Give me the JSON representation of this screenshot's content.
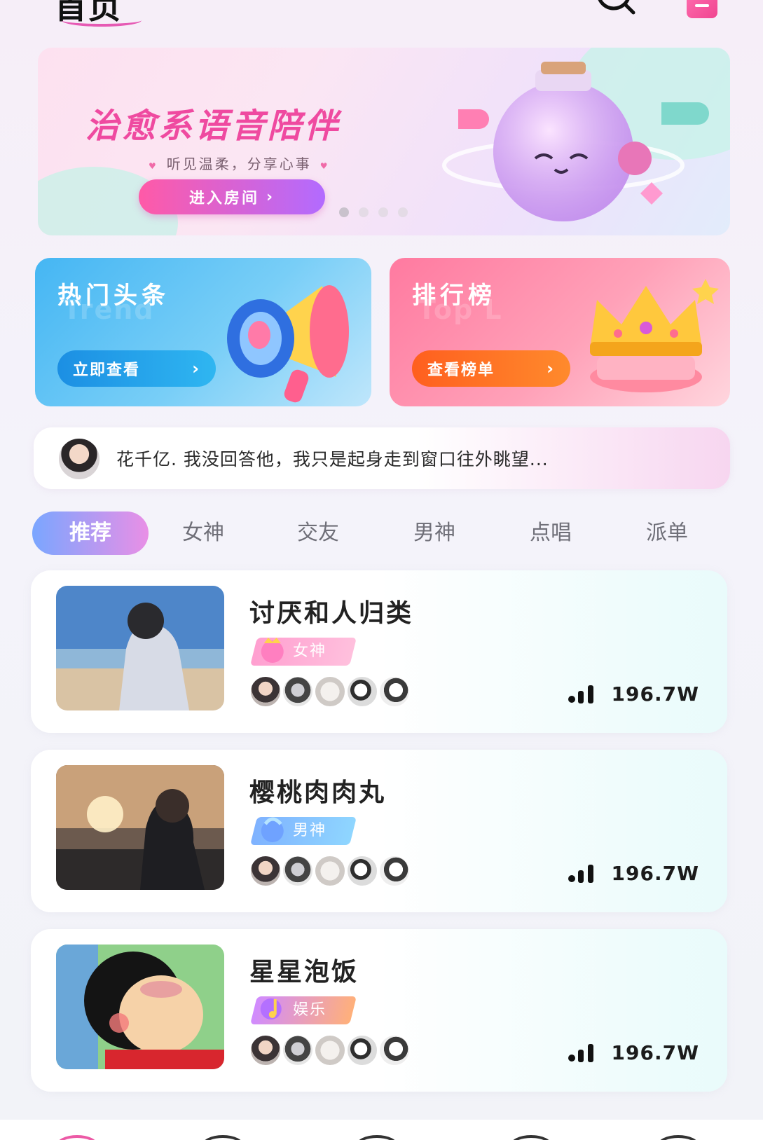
{
  "header": {
    "title": "首页",
    "search_icon": "search-icon",
    "menu_icon": "menu-icon"
  },
  "hero": {
    "title": "治愈系语音陪伴",
    "subtitle": "听见温柔，分享心事",
    "button_label": "进入房间",
    "button_chevron": "›",
    "carousel_pages": 4,
    "carousel_active": 1
  },
  "promos": [
    {
      "title": "热门头条",
      "ghost": "Trend",
      "button_label": "立即查看",
      "chevron": "›",
      "icon": "megaphone-icon"
    },
    {
      "title": "排行榜",
      "ghost": "Top L",
      "button_label": "查看榜单",
      "chevron": "›",
      "icon": "crown-icon"
    }
  ],
  "notice": {
    "text": "花千亿. 我没回答他，我只是起身走到窗口往外眺望..."
  },
  "tabs": [
    "推荐",
    "女神",
    "交友",
    "男神",
    "点唱",
    "派单"
  ],
  "active_tab": 0,
  "rooms": [
    {
      "name": "讨厌和人归类",
      "tag": "女神",
      "heat": "196.7W"
    },
    {
      "name": "樱桃肉肉丸",
      "tag": "男神",
      "heat": "196.7W"
    },
    {
      "name": "星星泡饭",
      "tag": "娱乐",
      "heat": "196.7W"
    }
  ],
  "colors": {
    "accent_pink": "#ef4aa0",
    "accent_purple": "#b26bff",
    "blue": "#45b6f3",
    "orange": "#ff6a22"
  }
}
